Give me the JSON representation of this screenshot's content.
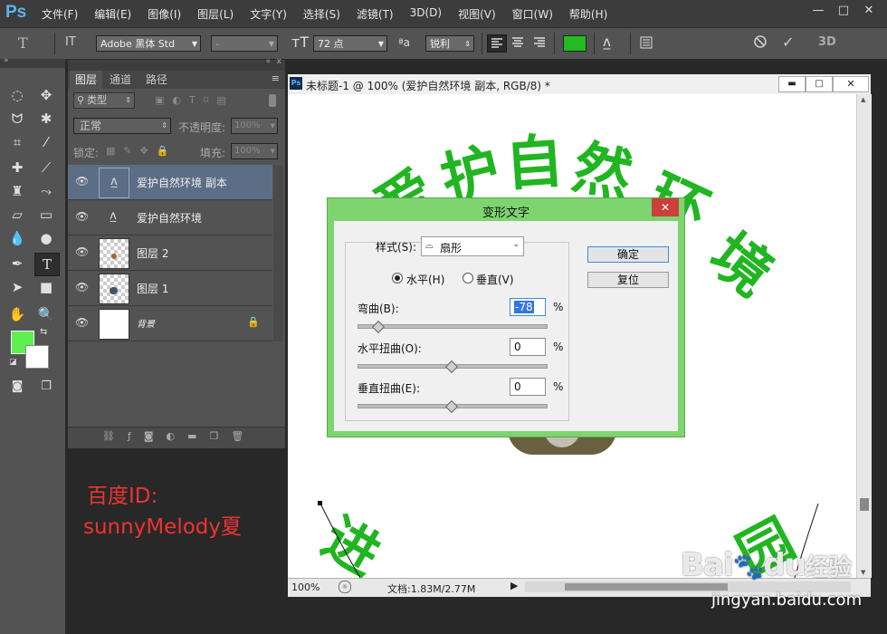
{
  "app": {
    "logo": "Ps"
  },
  "menu": [
    "文件(F)",
    "编辑(E)",
    "图像(I)",
    "图层(L)",
    "文字(Y)",
    "选择(S)",
    "滤镜(T)",
    "3D(D)",
    "视图(V)",
    "窗口(W)",
    "帮助(H)"
  ],
  "window_controls": {
    "minimize": "—",
    "maximize": "□",
    "close": "✕"
  },
  "options": {
    "tool_icon": "T",
    "orient_icon": "IT",
    "font_family": "Adobe 黑体 Std",
    "font_style": "-",
    "font_size": "72 点",
    "aa_icon": "ªa",
    "aa_mode": "锐利",
    "text_color": "#22bb22",
    "mode_3d": "3D"
  },
  "panel": {
    "tabs": [
      "图层",
      "通道",
      "路径"
    ],
    "filter_kind": "类型",
    "blend_mode": "正常",
    "opacity_label": "不透明度:",
    "opacity_value": "100%",
    "lock_label": "锁定:",
    "fill_label": "填充:",
    "fill_value": "100%",
    "layers": [
      {
        "name": "爱护自然环境 副本",
        "selected": true
      },
      {
        "name": "爱护自然环境",
        "selected": false
      },
      {
        "name": "图层 2",
        "selected": false
      },
      {
        "name": "图层 1",
        "selected": false
      },
      {
        "name": "背景",
        "selected": false
      }
    ]
  },
  "watermark_left": {
    "line1": "百度ID:",
    "line2": "sunnyMelody夏"
  },
  "document": {
    "title": "未标题-1 @ 100% (爱护自然环境 副本, RGB/8) *",
    "ps_icon": "Ps",
    "arc_text": "爱护自然环境",
    "zoom": "100%",
    "doc_info": "文档:1.83M/2.77M"
  },
  "dialog": {
    "title": "变形文字",
    "close": "✕",
    "style_label": "样式(S):",
    "style_value": "扇形",
    "ok": "确定",
    "reset": "复位",
    "horizontal": "水平(H)",
    "vertical": "垂直(V)",
    "bend_label": "弯曲(B):",
    "bend_value": "-78",
    "bend_level": -0.78,
    "hdist_label": "水平扭曲(O):",
    "hdist_value": "0",
    "hdist_level": 0,
    "vdist_label": "垂直扭曲(E):",
    "vdist_value": "0",
    "vdist_level": 0,
    "percent": "%"
  },
  "baidu": {
    "logo_text": "Bai",
    "logo_du": "du",
    "jingyan": "经验",
    "url": "jingyan.baidu.com"
  }
}
